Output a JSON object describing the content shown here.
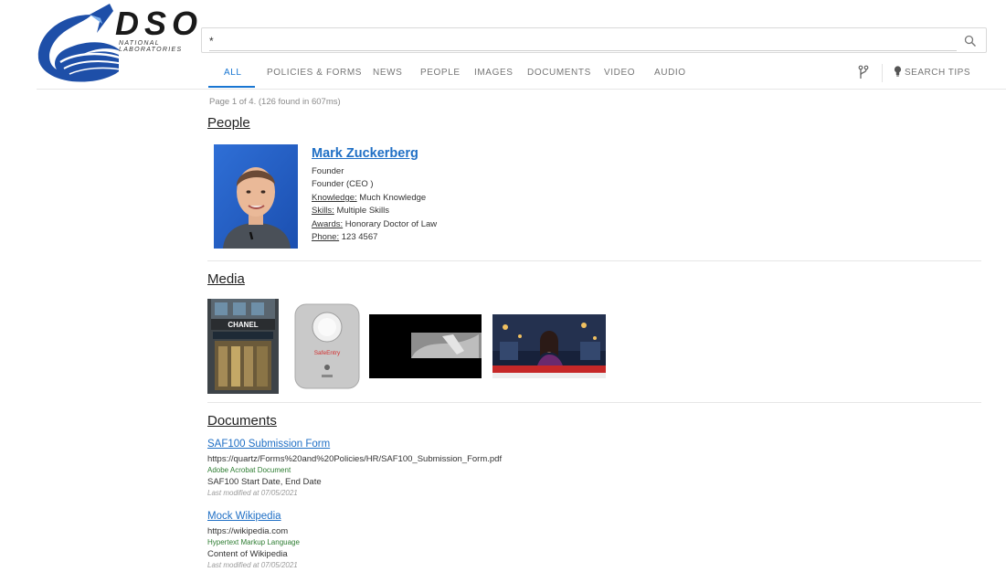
{
  "brand": {
    "name": "DSO",
    "subtitle_line1": "NATIONAL",
    "subtitle_line2": "LABORATORIES"
  },
  "search": {
    "value": "*",
    "placeholder": ""
  },
  "tabs": [
    {
      "label": "ALL",
      "active": true
    },
    {
      "label": "POLICIES & FORMS",
      "active": false
    },
    {
      "label": "NEWS",
      "active": false
    },
    {
      "label": "PEOPLE",
      "active": false
    },
    {
      "label": "IMAGES",
      "active": false
    },
    {
      "label": "DOCUMENTS",
      "active": false
    },
    {
      "label": "VIDEO",
      "active": false
    },
    {
      "label": "AUDIO",
      "active": false
    }
  ],
  "toolbar": {
    "search_tips": "SEARCH TIPS"
  },
  "status": "Page 1 of 4. (126 found in 607ms)",
  "sections": {
    "people": "People",
    "media": "Media",
    "documents": "Documents"
  },
  "person": {
    "name": "Mark Zuckerberg",
    "line1": "Founder",
    "line2": "Founder (CEO )",
    "knowledge_label": "Knowledge:",
    "knowledge": "Much Knowledge",
    "skills_label": "Skills:",
    "skills": "Multiple Skills",
    "awards_label": "Awards:",
    "awards": "Honorary Doctor of Law",
    "phone_label": "Phone:",
    "phone": "123 4567"
  },
  "media": {
    "chanel_sign": "CHANEL",
    "device_label": "SafeEntry"
  },
  "documents": [
    {
      "title": "SAF100 Submission Form",
      "url": "https://quartz/Forms%20and%20Policies/HR/SAF100_Submission_Form.pdf",
      "type": "Adobe Acrobat Document",
      "desc": "SAF100 Start Date, End Date",
      "modified": "Last modified at 07/05/2021"
    },
    {
      "title": "Mock Wikipedia",
      "url": "https://wikipedia.com",
      "type": "Hypertext Markup Language",
      "desc": "Content of Wikipedia",
      "modified": "Last modified at 07/05/2021"
    }
  ],
  "colors": {
    "accent": "#1976d2",
    "link": "#1f6fc5",
    "mime": "#2e7d32",
    "logo_blue": "#1e4fa8"
  }
}
